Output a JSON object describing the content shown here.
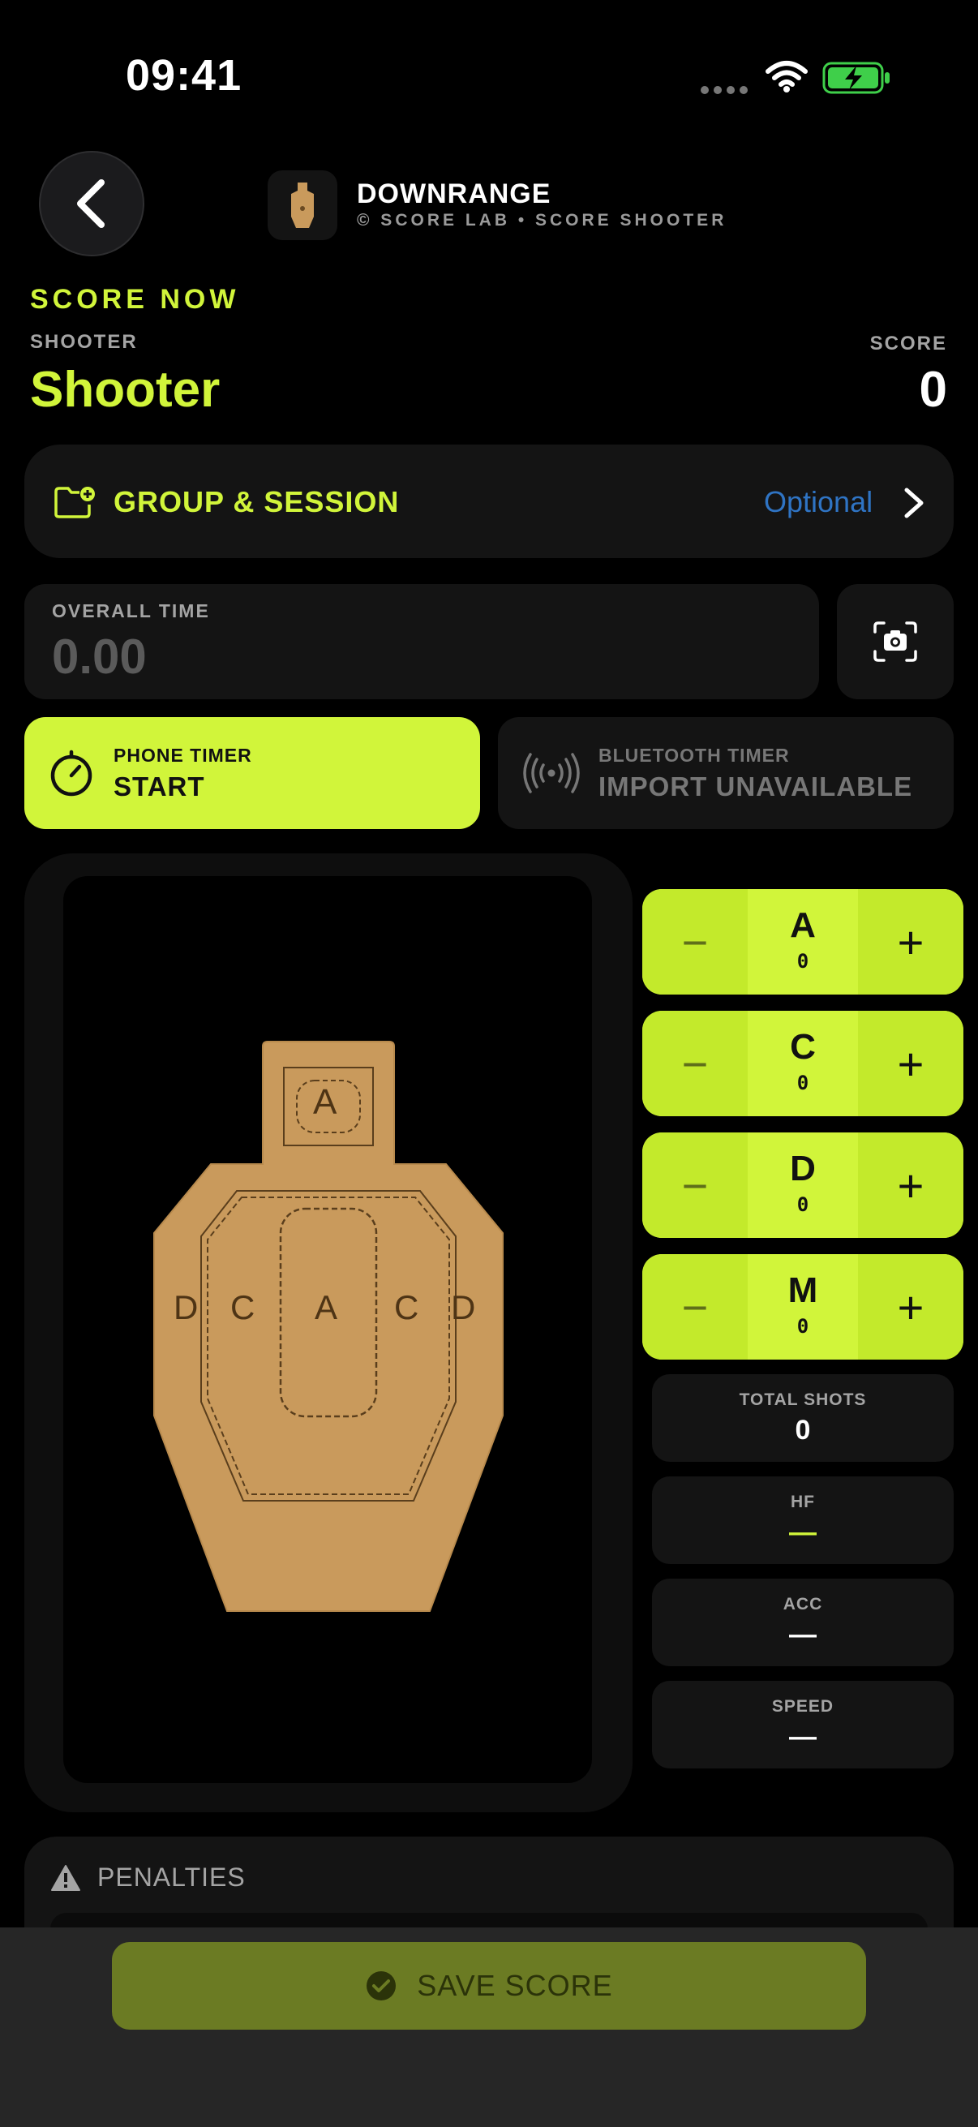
{
  "status_bar": {
    "time": "09:41"
  },
  "header": {
    "back_icon": "chevron-left-icon",
    "app_title": "DOWNRANGE",
    "app_subtitle": "© SCORE LAB • SCORE SHOOTER"
  },
  "section": {
    "title": "SCORE NOW"
  },
  "shooter": {
    "label": "SHOOTER",
    "name": "Shooter"
  },
  "score": {
    "label": "SCORE",
    "value": "0"
  },
  "group_session": {
    "label": "GROUP & SESSION",
    "optional": "Optional",
    "icon": "folder-plus-icon"
  },
  "overall_time": {
    "label": "OVERALL TIME",
    "value": "0.00",
    "camera_icon": "camera-scan-icon"
  },
  "phone_timer": {
    "label": "PHONE TIMER",
    "action": "START",
    "icon": "stopwatch-icon"
  },
  "bluetooth_timer": {
    "label": "BLUETOOTH TIMER",
    "status": "IMPORT UNAVAILABLE",
    "icon": "broadcast-icon"
  },
  "target": {
    "zone_labels": {
      "head": "A",
      "left_outer": "D",
      "left_inner": "C",
      "center": "A",
      "right_inner": "C",
      "right_outer": "D"
    }
  },
  "counters": [
    {
      "letter": "A",
      "count": "0",
      "minus": "−",
      "plus": "+"
    },
    {
      "letter": "C",
      "count": "0",
      "minus": "−",
      "plus": "+"
    },
    {
      "letter": "D",
      "count": "0",
      "minus": "−",
      "plus": "+"
    },
    {
      "letter": "M",
      "count": "0",
      "minus": "−",
      "plus": "+"
    }
  ],
  "stats": [
    {
      "label": "TOTAL SHOTS",
      "value": "0"
    },
    {
      "label": "HF",
      "value": "—"
    },
    {
      "label": "ACC",
      "value": "—"
    },
    {
      "label": "SPEED",
      "value": "—"
    }
  ],
  "penalties": {
    "label": "PENALTIES",
    "icon": "warning-icon"
  },
  "save": {
    "label": "SAVE SCORE",
    "icon": "check-circle-icon"
  },
  "colors": {
    "accent": "#d1f53a",
    "link": "#2f74c4",
    "card": "#141414",
    "target": "#c99a5c"
  }
}
